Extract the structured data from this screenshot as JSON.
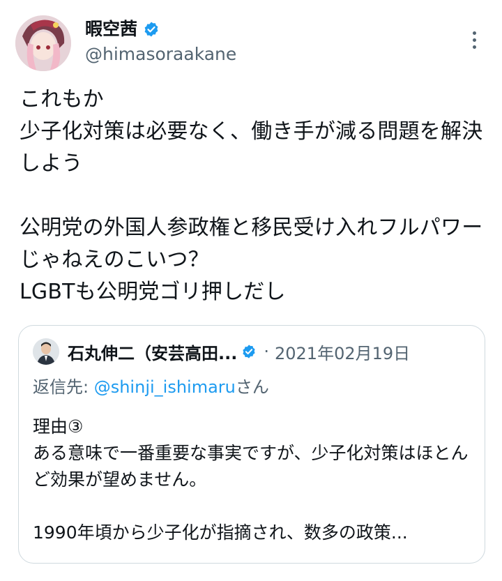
{
  "author": {
    "display_name": "暇空茜",
    "handle": "@himasoraakane"
  },
  "tweet": {
    "text": "これもか\n少子化対策は必要なく、働き手が減る問題を解決しよう\n\n公明党の外国人参政権と移民受け入れフルパワーじゃねえのこいつ？\nLGBTも公明党ゴリ押しだし"
  },
  "quoted": {
    "display_name": "石丸伸二（安芸高田...",
    "separator": "·",
    "date": "2021年02月19日",
    "reply_prefix": "返信先: ",
    "reply_mention": "@shinji_ishimaru",
    "reply_suffix": "さん",
    "text": "理由③\nある意味で一番重要な事実ですが、少子化対策はほとんど効果が望めません。\n\n1990年頃から少子化が指摘され、数多の政策..."
  },
  "colors": {
    "text": "#0f1419",
    "secondary": "#536471",
    "accent": "#1d9bf0",
    "border": "#cfd9de"
  },
  "icons": [
    "avatar",
    "verified-badge-icon",
    "more-options-icon"
  ]
}
